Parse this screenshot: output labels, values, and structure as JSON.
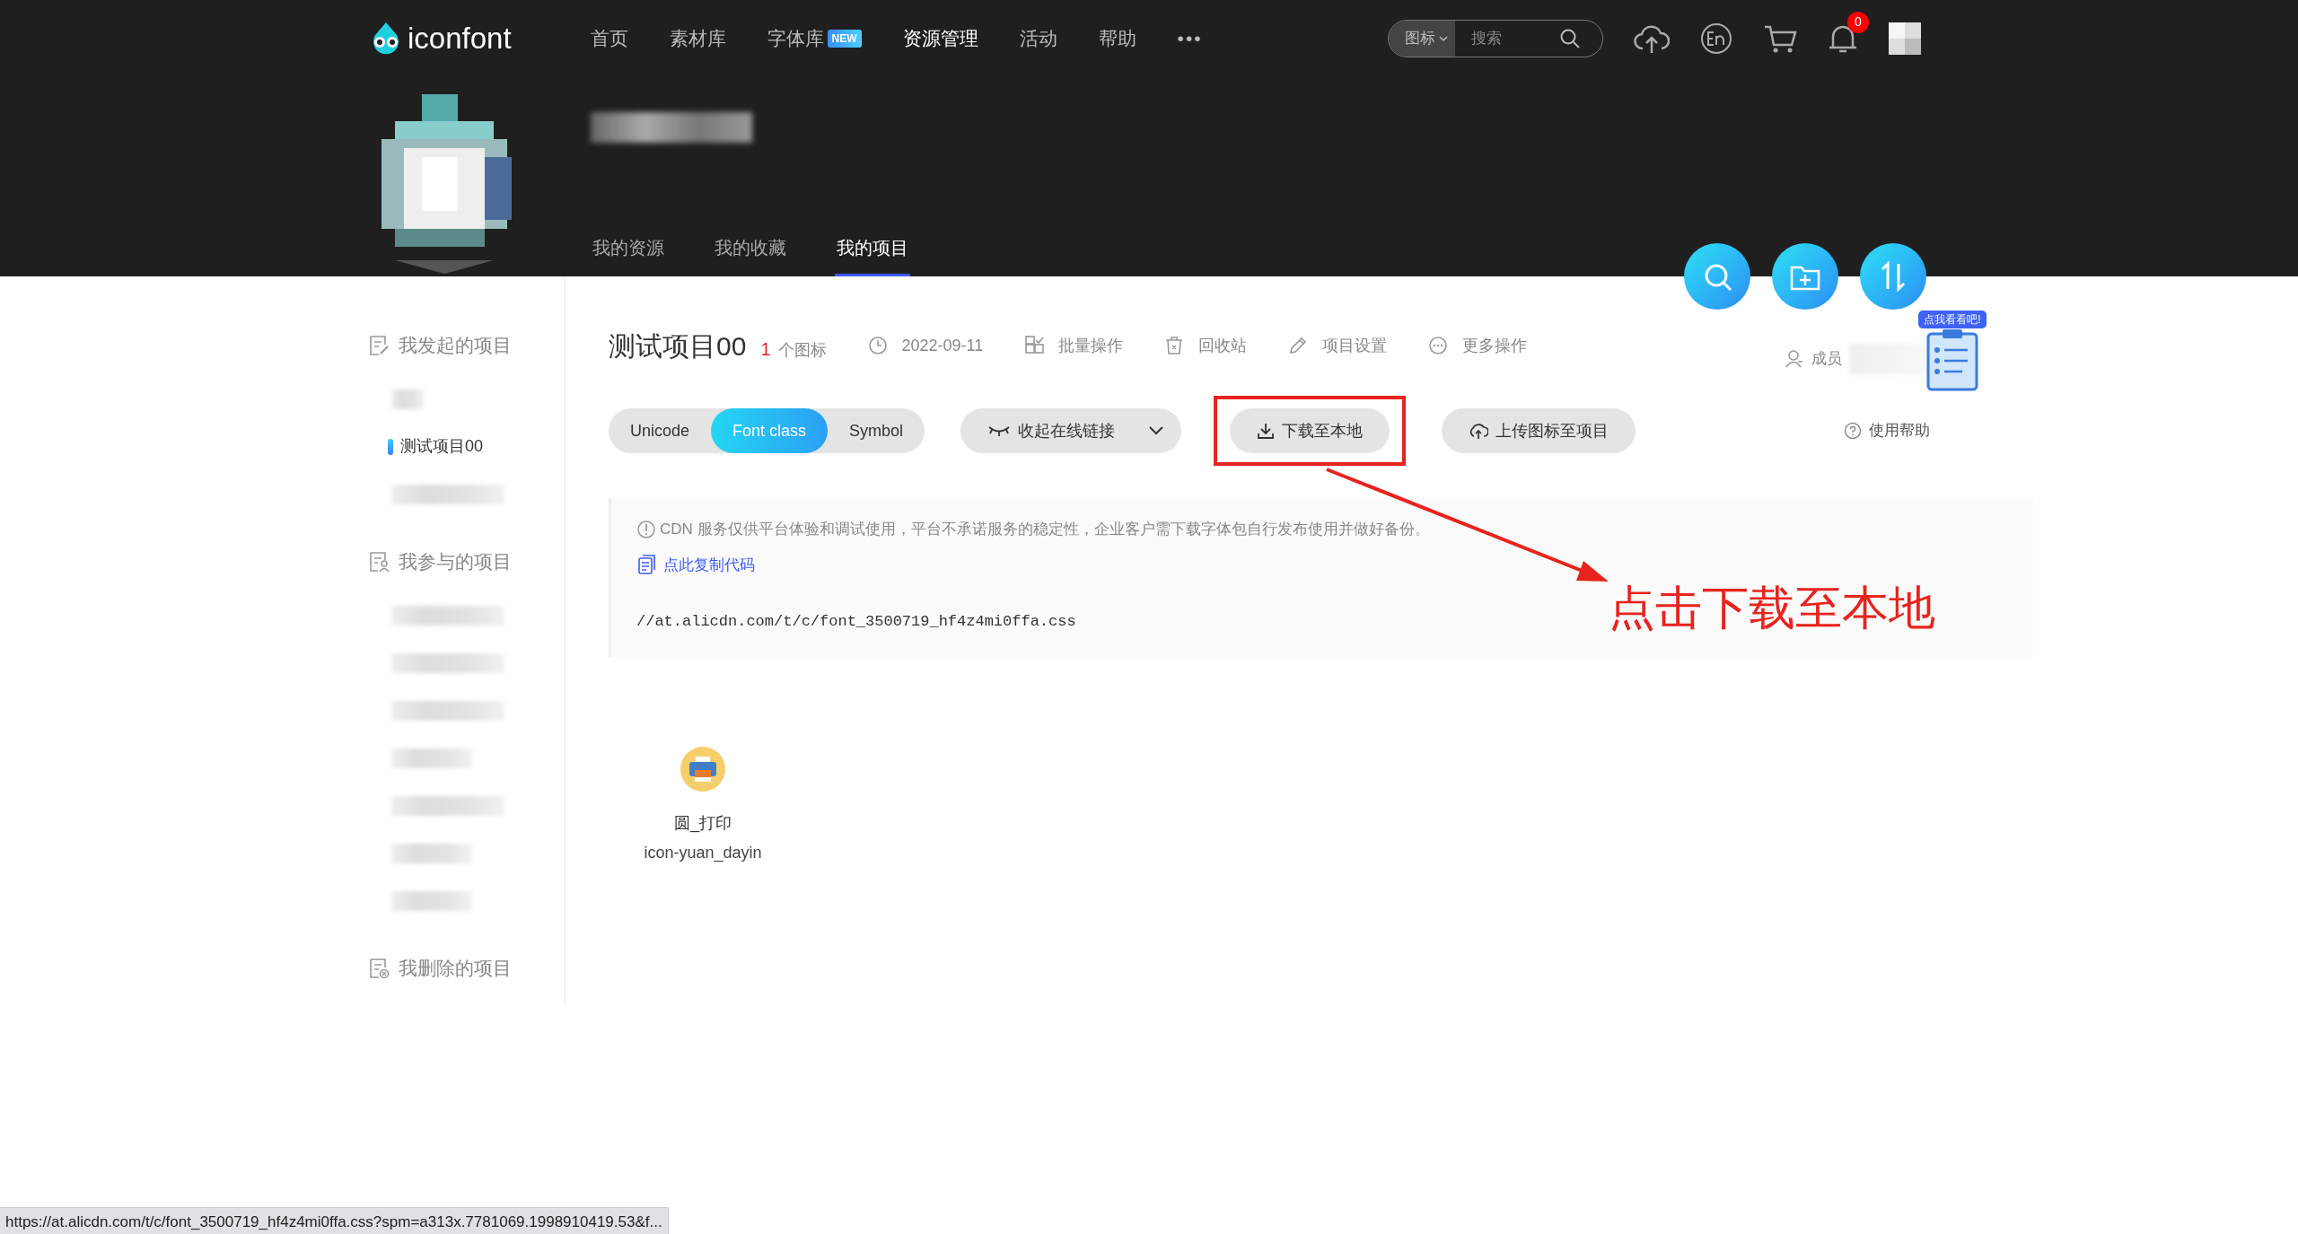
{
  "top_nav": {
    "logo": "iconfont",
    "items": [
      {
        "label": "首页",
        "selected": false
      },
      {
        "label": "素材库",
        "selected": false
      },
      {
        "label": "字体库",
        "badge": "NEW",
        "selected": false
      },
      {
        "label": "资源管理",
        "selected": true
      },
      {
        "label": "活动",
        "selected": false
      },
      {
        "label": "帮助",
        "selected": false
      }
    ],
    "more": "•••",
    "search": {
      "scope": "图标",
      "placeholder": "搜索"
    },
    "notification_count": "0"
  },
  "profile_tabs": [
    {
      "label": "我的资源",
      "selected": false
    },
    {
      "label": "我的收藏",
      "selected": false
    },
    {
      "label": "我的项目",
      "selected": true
    }
  ],
  "sidebar": {
    "sections": [
      {
        "kind": "created",
        "title": "我发起的项目",
        "items": [
          {
            "kind": "blurred",
            "selected": false
          },
          {
            "kind": "project",
            "label": "测试项目00",
            "selected": true
          },
          {
            "kind": "blurred",
            "selected": false
          }
        ]
      },
      {
        "kind": "joined",
        "title": "我参与的项目",
        "items": [
          {
            "kind": "blurred",
            "selected": false
          },
          {
            "kind": "blurred",
            "selected": false
          },
          {
            "kind": "blurred",
            "selected": false
          },
          {
            "kind": "blurred",
            "selected": false
          },
          {
            "kind": "blurred",
            "selected": false
          },
          {
            "kind": "blurred",
            "selected": false
          },
          {
            "kind": "blurred",
            "selected": false
          }
        ]
      },
      {
        "kind": "deleted",
        "title": "我删除的项目"
      }
    ]
  },
  "project": {
    "title": "测试项目00",
    "icon_count": "1",
    "icon_count_label": "个图标",
    "actions": [
      {
        "kind": "date",
        "label": "2022-09-11"
      },
      {
        "kind": "batch",
        "label": "批量操作"
      },
      {
        "kind": "trash",
        "label": "回收站"
      },
      {
        "kind": "settings",
        "label": "项目设置"
      },
      {
        "kind": "more",
        "label": "更多操作"
      }
    ],
    "members_label": "成员"
  },
  "toolbar": {
    "formats": [
      {
        "label": "Unicode",
        "selected": false
      },
      {
        "label": "Font class",
        "selected": true
      },
      {
        "label": "Symbol",
        "selected": false
      }
    ],
    "buttons": [
      {
        "kind": "collapse",
        "label": "收起在线链接",
        "highlighted": false
      },
      {
        "kind": "download",
        "label": "下载至本地",
        "highlighted": true
      },
      {
        "kind": "upload",
        "label": "上传图标至项目",
        "highlighted": false
      }
    ],
    "help": "使用帮助",
    "promo_badge": "点我看看吧!"
  },
  "cdn": {
    "notice": "CDN 服务仅供平台体验和调试使用，平台不承诺服务的稳定性，企业客户需下载字体包自行发布使用并做好备份。",
    "copy_link": "点此复制代码",
    "url": "//at.alicdn.com/t/c/font_3500719_hf4z4mi0ffa.css"
  },
  "icons": [
    {
      "name": "圆_打印",
      "code": "icon-yuan_dayin"
    }
  ],
  "annotation": {
    "text": "点击下载至本地"
  },
  "status_bar": {
    "url": "https://at.alicdn.com/t/c/font_3500719_hf4z4mi0ffa.css?spm=a313x.7781069.1998910419.53&f..."
  }
}
